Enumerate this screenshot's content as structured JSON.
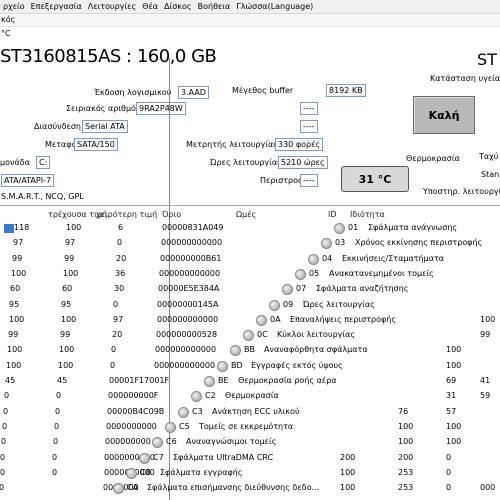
{
  "menu": [
    "ρχείο",
    "Επεξεργασία",
    "Λειτουργίες",
    "Θέα",
    "Δίσκος",
    "Βοήθεια",
    "Γλώσσα(Language)"
  ],
  "subbar": {
    "label": "κός",
    "temp": "°C"
  },
  "disk": {
    "model": "ST3160815AS : 160,0 GB",
    "model_cut": "ST",
    "firmware_label": "Έκδοση λογισμικού",
    "firmware": "3.AAD",
    "serial_label": "Σειριακός αριθμός",
    "serial": "9RA2P48W",
    "interface_label": "Διασύνδεση",
    "interface": "Serial ATA",
    "transfer_label": "Μεταφορά",
    "transfer": "SATA/150",
    "drive_label": "μονάδα",
    "drive": "C:",
    "standard": "ATA/ATAPI-7",
    "features": "S.M.A.R.T., NCQ, GPL",
    "buffer_label": "Μέγεθος buffer",
    "buffer": "8192 KB",
    "dash1": "----",
    "dash2": "----",
    "power_count_label": "Μετρητής λειτουργίας",
    "power_count": "330 φορές",
    "hours_label": "Ώρες λειτουργίας",
    "hours": "5210 ώρες",
    "rotation_label": "Περιστροφή",
    "rotation": "----",
    "status_label": "Κατάσταση υγείας",
    "status": "Καλή",
    "temp_label": "Θερμοκρασία",
    "temp": "31 °C",
    "right_label1": "Ταχύ",
    "right_label2": "Stan",
    "support_label": "Υποστηρ. λειτουργίες"
  },
  "smart_headers": [
    "τρέχουσα τιμή",
    "χειρότερη τιμή",
    "Όριο",
    "Ωμές",
    "ID",
    "Ιδιότητα"
  ],
  "left_rows": [
    [
      "118",
      "100",
      "6",
      "00000831A049"
    ],
    [
      "97",
      "97",
      "0",
      "000000000000"
    ],
    [
      "99",
      "99",
      "20",
      "000000000B61"
    ],
    [
      "100",
      "100",
      "36",
      "000000000000"
    ],
    [
      "60",
      "60",
      "30",
      "00000E5E384A"
    ],
    [
      "95",
      "95",
      "0",
      "00000000145A"
    ],
    [
      "100",
      "100",
      "97",
      "000000000000"
    ],
    [
      "99",
      "99",
      "20",
      "000000000528"
    ],
    [
      "100",
      "100",
      "0",
      "000000000000"
    ],
    [
      "100",
      "100",
      "0",
      "000000000000"
    ],
    [
      "45",
      "45",
      "00001F17001F"
    ],
    [
      "0",
      "0",
      "000000000F"
    ],
    [
      "0",
      "0",
      "00000B4C09B"
    ],
    [
      "0",
      "0",
      "0000000000"
    ],
    [
      "0",
      "0",
      "000000000"
    ],
    [
      "0",
      "0",
      "0000000000"
    ],
    [
      "0",
      "0",
      "0000000000"
    ],
    [
      "0",
      "",
      "0000000"
    ]
  ],
  "attr_rows": [
    [
      "01",
      "Σφάλματα ανάγνωσης"
    ],
    [
      "03",
      "Χρόνος εκκίνησης περιστροφής"
    ],
    [
      "04",
      "Εκκινήσεις/Σταματήματα"
    ],
    [
      "05",
      "Ανακατανεμημένοι τομείς"
    ],
    [
      "07",
      "Σφάλματα αναζήτησης"
    ],
    [
      "09",
      "Ώρες λειτουργίας"
    ],
    [
      "0A",
      "Επαναλήψεις περιστροφής"
    ],
    [
      "0C",
      "Κύκλοι λειτουργίας"
    ],
    [
      "BB",
      "Αναναφόρθητα σφάλματα"
    ],
    [
      "BD",
      "Εγγραφές εκτός ύψους"
    ],
    [
      "BE",
      "Θερμοκρασία ροής αέρα"
    ],
    [
      "C2",
      "Θερμοκρασία"
    ],
    [
      "C3",
      "Ανάκτηση ECC υλικού"
    ],
    [
      "C5",
      "Τομείς σε εκκρεμότητα"
    ],
    [
      "C6",
      "Αναναγνώσιμοι τομείς"
    ],
    [
      "C7",
      "Σφάλματα UltraDMA CRC"
    ],
    [
      "C8",
      "Σφάλματα εγγραφής"
    ],
    [
      "CA",
      "Σφάλματα επισήμανσης διεύθυνσης δεδο..."
    ]
  ],
  "right_rows": [
    [
      "",
      "",
      "",
      ""
    ],
    [
      "",
      "",
      "",
      ""
    ],
    [
      "",
      "",
      "",
      ""
    ],
    [
      "",
      "",
      "",
      ""
    ],
    [
      "",
      "",
      "",
      ""
    ],
    [
      "",
      "",
      "",
      ""
    ],
    [
      "",
      "",
      "",
      "100"
    ],
    [
      "",
      "",
      "",
      "99"
    ],
    [
      "",
      "",
      "100",
      ""
    ],
    [
      "",
      "",
      "100",
      ""
    ],
    [
      "",
      "",
      "69",
      "41"
    ],
    [
      "",
      "",
      "31",
      "59"
    ],
    [
      "",
      "76",
      "57",
      ""
    ],
    [
      "",
      "100",
      "100",
      ""
    ],
    [
      "",
      "100",
      "100",
      ""
    ],
    [
      "200",
      "200",
      "0",
      ""
    ],
    [
      "100",
      "253",
      "0",
      ""
    ],
    [
      "100",
      "253",
      "0",
      "000"
    ]
  ]
}
